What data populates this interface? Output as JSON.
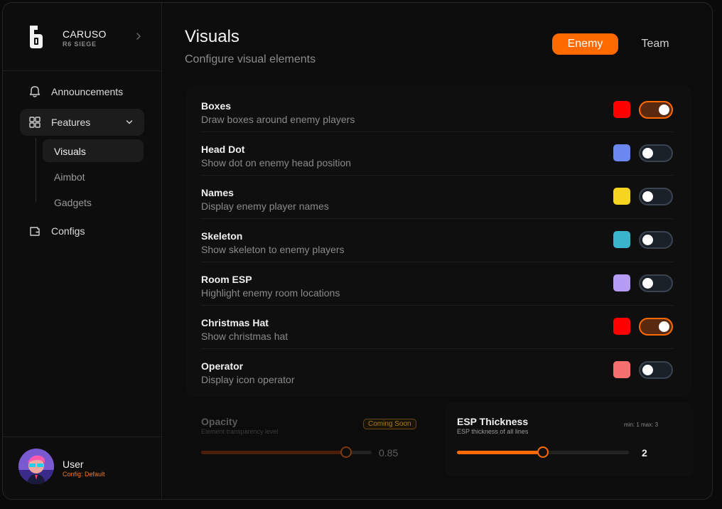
{
  "brand": {
    "name": "CARUSO",
    "subtitle": "R6 SIEGE"
  },
  "nav": {
    "announcements": "Announcements",
    "features": "Features",
    "sub": [
      "Visuals",
      "Aimbot",
      "Gadgets"
    ],
    "configs": "Configs"
  },
  "user": {
    "name": "User",
    "config": "Config: Default"
  },
  "header": {
    "title": "Visuals",
    "subtitle": "Configure visual elements"
  },
  "tabs": [
    {
      "label": "Enemy",
      "active": true
    },
    {
      "label": "Team",
      "active": false
    }
  ],
  "features": [
    {
      "name": "Boxes",
      "desc": "Draw boxes around enemy players",
      "color": "#ff0000",
      "enabled": true
    },
    {
      "name": "Head Dot",
      "desc": "Show dot on enemy head position",
      "color": "#6b87f0",
      "enabled": false
    },
    {
      "name": "Names",
      "desc": "Display enemy player names",
      "color": "#f5d51f",
      "enabled": false
    },
    {
      "name": "Skeleton",
      "desc": "Show skeleton to enemy players",
      "color": "#3ab4cc",
      "enabled": false
    },
    {
      "name": "Room ESP",
      "desc": "Highlight enemy room locations",
      "color": "#b59cf5",
      "enabled": false
    },
    {
      "name": "Christmas Hat",
      "desc": "Show christmas hat",
      "color": "#ff0000",
      "enabled": true
    },
    {
      "name": "Operator",
      "desc": "Display icon operator",
      "color": "#f77070",
      "enabled": false
    }
  ],
  "sliders": {
    "opacity": {
      "title": "Opacity",
      "desc": "Element transparency level",
      "badge": "Coming Soon",
      "value": "0.85",
      "fraction": 0.85
    },
    "esp": {
      "title": "ESP Thickness",
      "desc": "ESP thickness of all lines",
      "range_label": "min: 1  max: 3",
      "value": "2",
      "min": 1,
      "max": 3,
      "current": 2
    }
  },
  "colors": {
    "accent": "#ff6a00"
  }
}
